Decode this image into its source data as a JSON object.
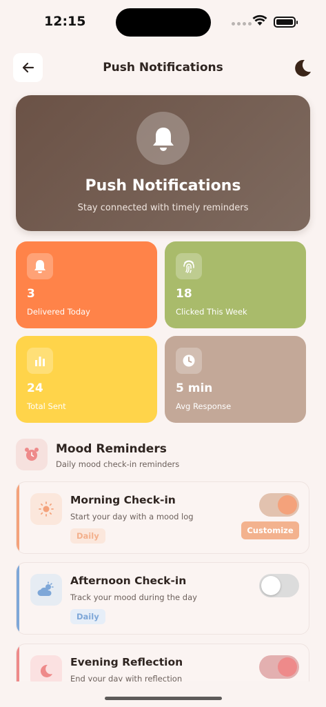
{
  "status_bar": {
    "time": "12:15"
  },
  "header": {
    "title": "Push Notifications"
  },
  "hero": {
    "title": "Push Notifications",
    "subtitle": "Stay connected with timely reminders"
  },
  "stats": [
    {
      "value": "3",
      "label": "Delivered Today",
      "color": "#ff8349",
      "icon": "bell-icon"
    },
    {
      "value": "18",
      "label": "Clicked This Week",
      "color": "#a9bb6b",
      "icon": "fingerprint-icon"
    },
    {
      "value": "24",
      "label": "Total Sent",
      "color": "#ffd44a",
      "icon": "bar-chart-icon"
    },
    {
      "value": "5 min",
      "label": "Avg Response",
      "color": "#c3a898",
      "icon": "clock-icon"
    }
  ],
  "section": {
    "title": "Mood Reminders",
    "subtitle": "Daily mood check-in reminders",
    "icon": "alarm-clock-icon"
  },
  "reminders": [
    {
      "title": "Morning Check-in",
      "subtitle": "Start your day with a mood log",
      "tag": "Daily",
      "enabled": true,
      "action": "Customize",
      "accent": "#f4a27b",
      "icon": "sun-icon"
    },
    {
      "title": "Afternoon Check-in",
      "subtitle": "Track your mood during the day",
      "tag": "Daily",
      "enabled": false,
      "accent": "#7ea7d8",
      "icon": "cloud-sun-icon"
    },
    {
      "title": "Evening Reflection",
      "subtitle": "End your day with reflection",
      "enabled": true,
      "accent": "#ee8a8a",
      "icon": "moon-icon"
    }
  ]
}
